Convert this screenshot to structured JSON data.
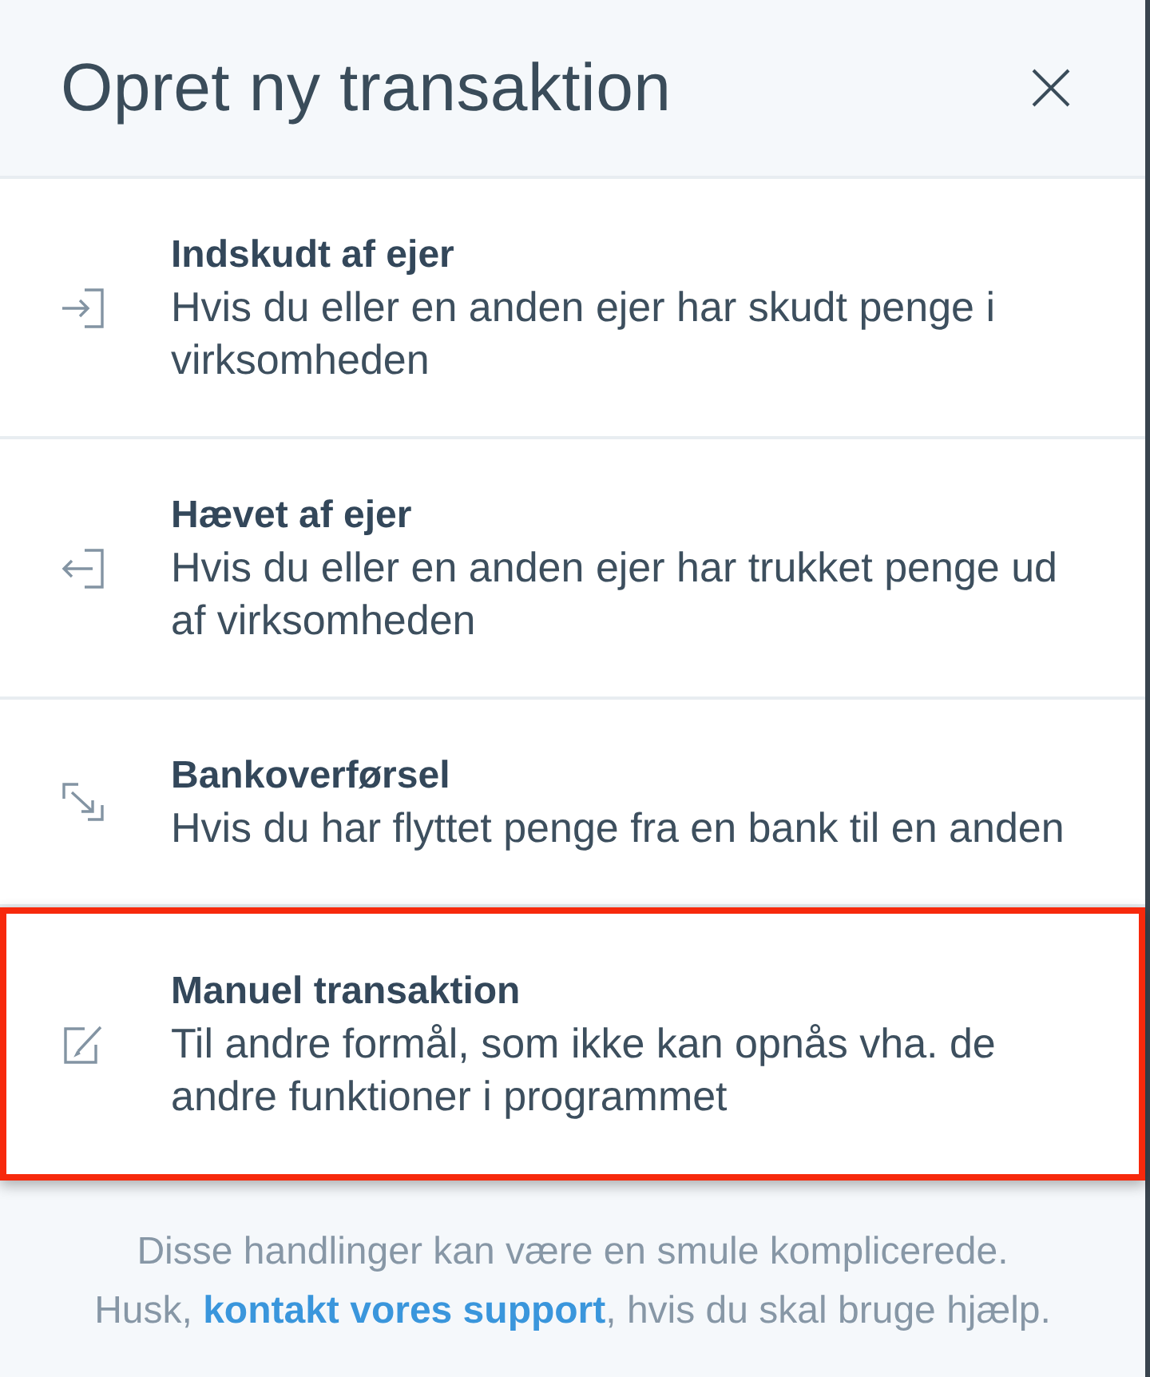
{
  "dialog": {
    "title": "Opret ny transaktion"
  },
  "items": [
    {
      "kind": "deposit",
      "title": "Indskudt af ejer",
      "description": "Hvis du eller en anden ejer har skudt penge i virksomheden",
      "selected": false
    },
    {
      "kind": "withdrawal",
      "title": "Hævet af ejer",
      "description": "Hvis du eller en anden ejer har trukket penge ud af virksomheden",
      "selected": false
    },
    {
      "kind": "transfer",
      "title": "Bankoverførsel",
      "description": "Hvis du har flyttet penge fra en bank til en anden",
      "selected": false
    },
    {
      "kind": "manual",
      "title": "Manuel transaktion",
      "description": "Til andre formål, som ikke kan opnås vha. de andre funktioner i programmet",
      "selected": true
    }
  ],
  "footer": {
    "note": "Disse handlinger kan være en smule komplicerede.",
    "help_before": "Husk, ",
    "link": "kontakt vores support",
    "help_after": ", hvis du skal bruge hjælp."
  }
}
